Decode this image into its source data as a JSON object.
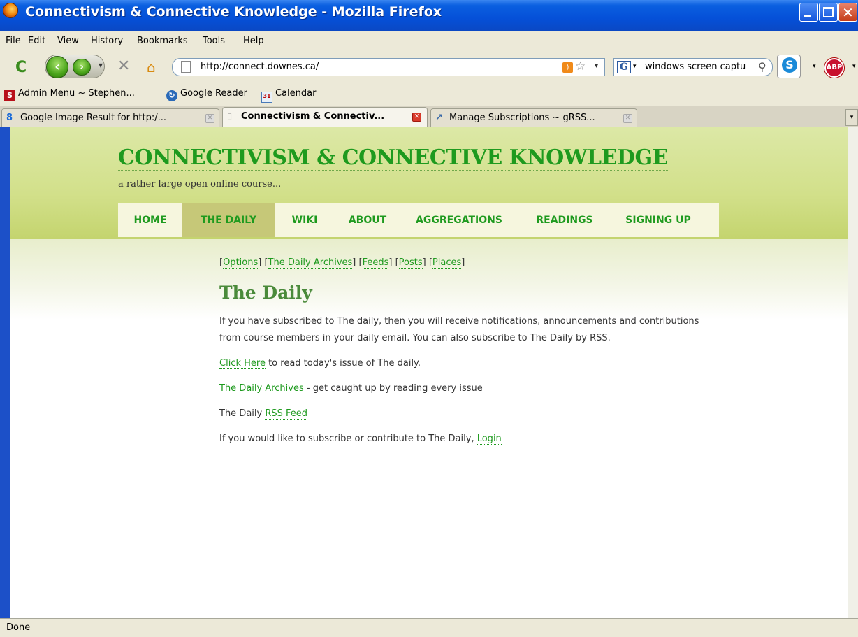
{
  "window": {
    "title": "Connectivism & Connective Knowledge - Mozilla Firefox",
    "icon": "firefox-icon",
    "colors": {
      "titlebar": "#0550d8",
      "close": "#c43c18"
    }
  },
  "menu": [
    "File",
    "Edit",
    "View",
    "History",
    "Bookmarks",
    "Tools",
    "Help"
  ],
  "navbar": {
    "url": "http://connect.downes.ca/",
    "search_value": "windows screen captu",
    "search_engine": "G",
    "abp_label": "ABP"
  },
  "bookmarks": [
    {
      "label": "Admin Menu ~ Stephen...",
      "icon": "s-icon"
    },
    {
      "label": "Google Reader",
      "icon": "google-reader-icon"
    },
    {
      "label": "Calendar",
      "icon": "calendar-icon"
    }
  ],
  "tabs": [
    {
      "label": "Google Image Result for http:/...",
      "icon": "google-icon",
      "active": false
    },
    {
      "label": "Connectivism & Connectiv...",
      "icon": "page-icon",
      "active": true
    },
    {
      "label": "Manage Subscriptions ~ gRSS...",
      "icon": "grss-icon",
      "active": false
    }
  ],
  "site": {
    "title": "CONNECTIVISM & CONNECTIVE KNOWLEDGE",
    "tagline": "a rather large open online course...",
    "nav": [
      "HOME",
      "THE DAILY",
      "WIKI",
      "ABOUT",
      "AGGREGATIONS",
      "READINGS",
      "SIGNING UP"
    ],
    "active_nav": "THE DAILY",
    "colors": {
      "accent": "#1e9a1e",
      "header": "#d2e08a",
      "active_tab": "#c6c878"
    }
  },
  "page": {
    "tools": [
      "Options",
      "The Daily Archives",
      "Feeds",
      "Posts",
      "Places"
    ],
    "heading": "The Daily",
    "intro_1": "If you have subscribed to The daily, then you will receive notifications, announcements and contributions",
    "intro_2": "from course members in your daily email. You can also subscribe to The Daily by RSS.",
    "click_link": "Click Here",
    "click_rest": " to read today's issue of The daily.",
    "archives_link": "The Daily Archives",
    "archives_rest": " - get caught up by reading every issue",
    "rss_prefix": "The Daily ",
    "rss_link": "RSS Feed",
    "login_prefix": "If you would like to subscribe or contribute to The Daily, ",
    "login_link": "Login"
  },
  "status": {
    "text": "Done"
  }
}
